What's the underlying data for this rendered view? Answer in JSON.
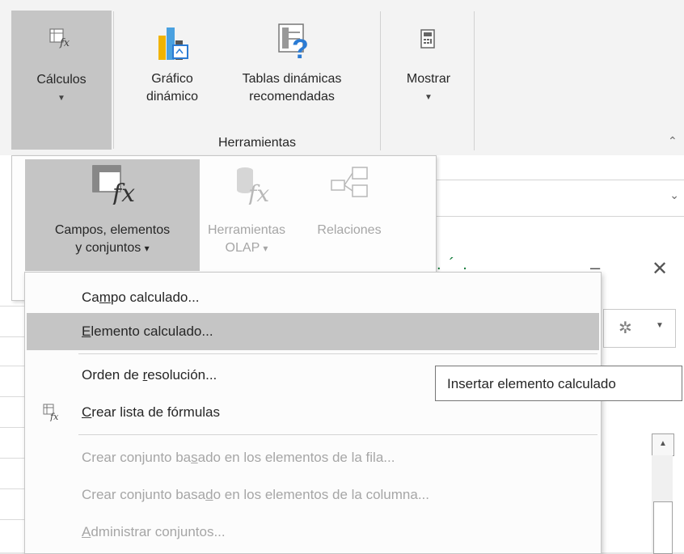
{
  "ribbon": {
    "calculos": {
      "label": "Cálculos",
      "icon": "calculations-fx-icon"
    },
    "grafico": {
      "line1": "Gráfico",
      "line2": "dinámico",
      "icon": "pivot-chart-icon"
    },
    "tablas": {
      "line1": "Tablas dinámicas",
      "line2": "recomendadas",
      "icon": "recommended-pivot-tables-icon"
    },
    "mostrar": {
      "label": "Mostrar",
      "icon": "show-calculator-icon"
    },
    "group_label": "Herramientas"
  },
  "tools": {
    "campos": {
      "line1": "Campos, elementos",
      "line2": "y conjuntos",
      "arrow": "▾"
    },
    "olap": {
      "line1": "Herramientas",
      "line2": "OLAP",
      "arrow": "▾"
    },
    "relaciones": {
      "label": "Relaciones"
    }
  },
  "menu": {
    "items": [
      {
        "pre": "Ca",
        "u": "m",
        "post": "po calculado..."
      },
      {
        "pre": "",
        "u": "E",
        "post": "lemento calculado..."
      },
      {
        "pre": "Orden de ",
        "u": "r",
        "post": "esolución..."
      },
      {
        "pre": "",
        "u": "C",
        "post": "rear lista de fórmulas"
      },
      {
        "pre": "Crear conjunto ba",
        "u": "s",
        "post": "ado en los elementos de la fila..."
      },
      {
        "pre": "Crear conjunto basa",
        "u": "d",
        "post": "o en los elementos de la columna..."
      },
      {
        "pre": "",
        "u": "A",
        "post": "dministrar conjuntos..."
      }
    ]
  },
  "tooltip": {
    "text": "Insertar elemento calculado"
  },
  "colors": {
    "highlight": "#c5c5c5",
    "disabled": "#a6a6a6",
    "accent_green": "#0f7b38"
  }
}
